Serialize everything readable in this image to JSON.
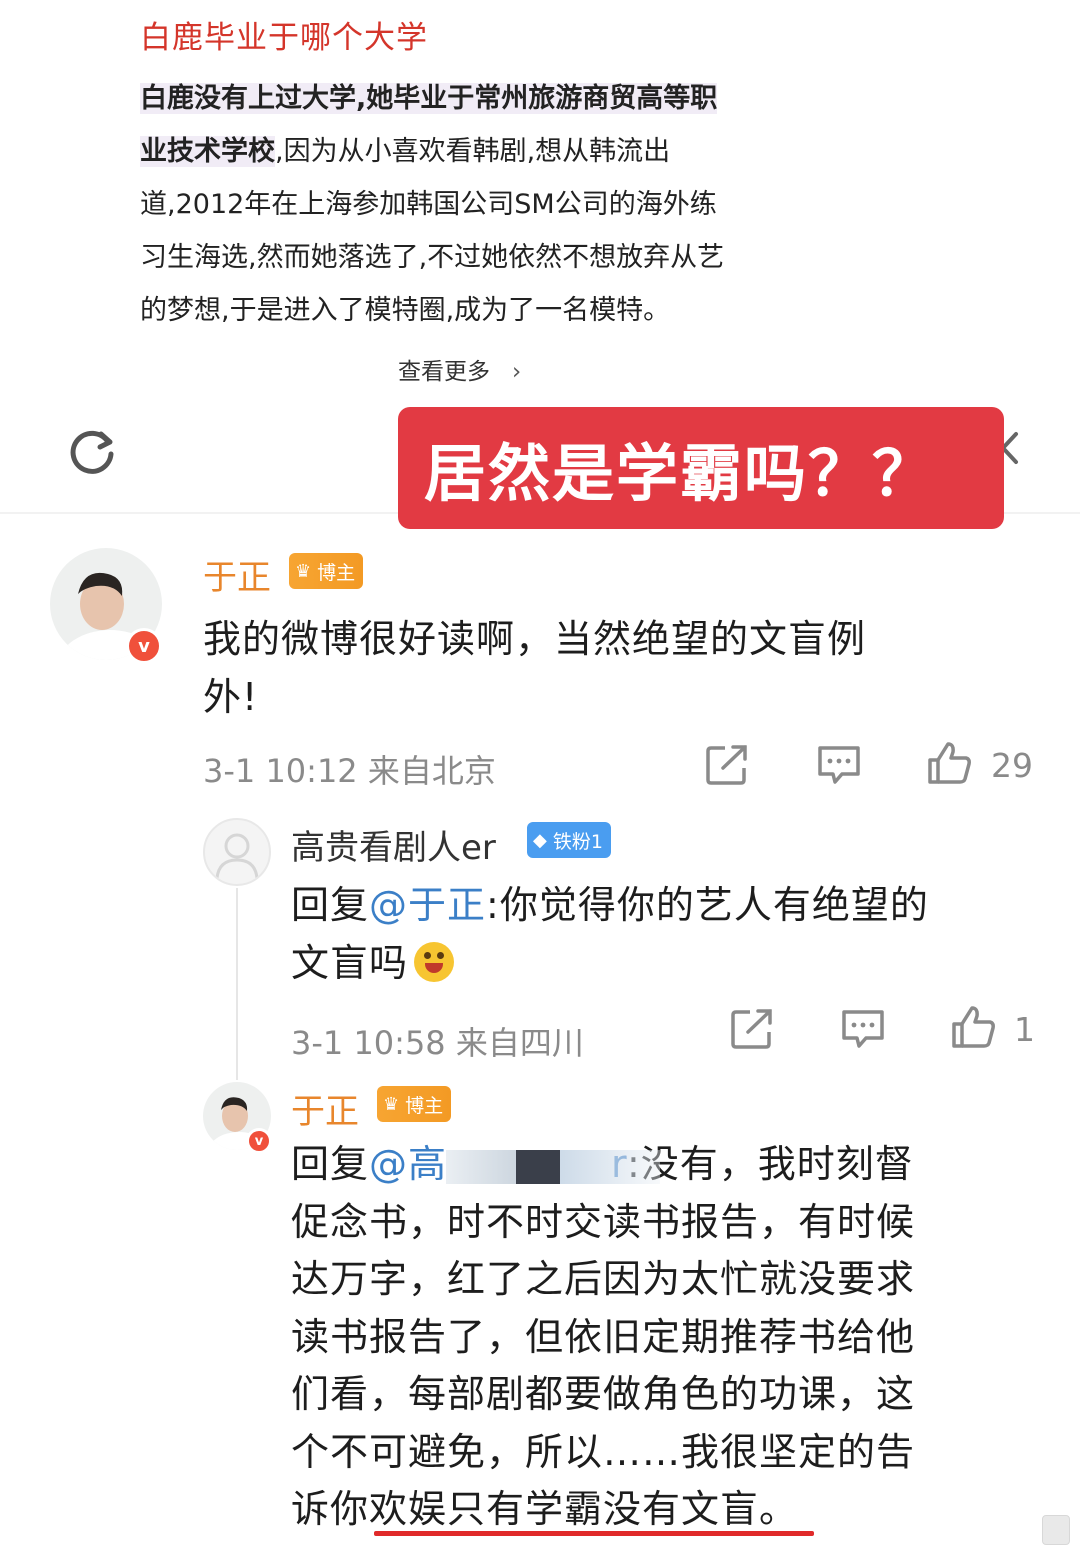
{
  "answer": {
    "title": "白鹿毕业于哪个大学",
    "lines": [
      {
        "bold": "白鹿没有上过大学,她毕业于常州旅游商贸高等职",
        "rest": ""
      },
      {
        "bold": "业技术学校",
        "rest": ",因为从小喜欢看韩剧,想从韩流出"
      },
      {
        "bold": "",
        "rest": "道,2012年在上海参加韩国公司SM公司的海外练"
      },
      {
        "bold": "",
        "rest": "习生海选,然而她落选了,不过她依然不想放弃从艺"
      },
      {
        "bold": "",
        "rest": "的梦想,于是进入了模特圈,成为了一名模特。"
      }
    ],
    "see_more": "查看更多",
    "see_more_icon": "chevron-right-icon"
  },
  "overlay": {
    "caption": "居然是学霸吗？？",
    "bg_color": "#e23a43"
  },
  "comments": [
    {
      "name": "于正",
      "tag": "博主",
      "text_lines": [
        "我的微博很好读啊，当然绝望的文盲例",
        "外!"
      ],
      "meta": "3-1 10:12 来自北京",
      "likes": "29"
    },
    {
      "name": "高贵看剧人er",
      "tag": "铁粉1",
      "reply_prefix": "回复",
      "mention": "@于正",
      "text_rest": ":你觉得你的艺人有绝望的",
      "text_line2": "文盲吗",
      "meta": "3-1 10:58 来自四川",
      "likes": "1"
    },
    {
      "name": "于正",
      "tag": "博主",
      "reply_prefix": "回复",
      "mention_visible": "@高",
      "mention_tail": "r",
      "text_first": ":没有，我时刻督",
      "text_lines": [
        "促念书，时不时交读书报告，有时候",
        "达万字，红了之后因为太忙就没要求",
        "读书报告了，但依旧定期推荐书给他",
        "们看，每部剧都要做角色的功课，这",
        "个不可避免，所以……我很坚定的告"
      ],
      "last_prefix": "诉你",
      "last_underlined": "欢娱只有学霸没有文盲",
      "last_suffix": "。"
    }
  ],
  "colors": {
    "brand_orange": "#e8862c",
    "mention_blue": "#3b7fc7",
    "title_red": "#d4352a"
  }
}
